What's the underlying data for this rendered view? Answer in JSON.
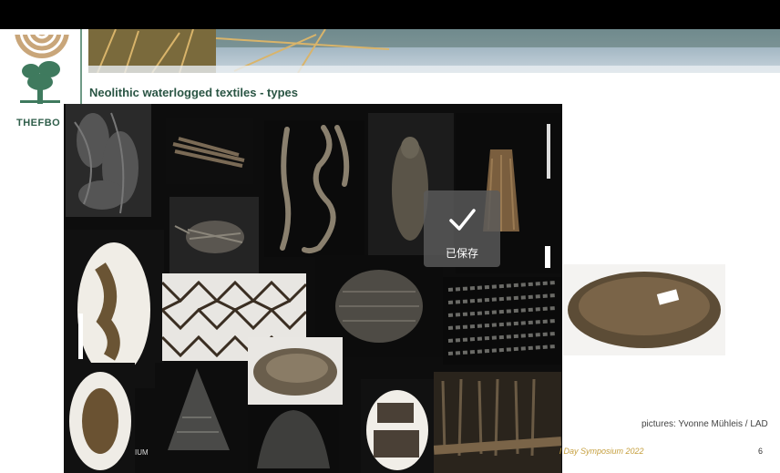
{
  "slide": {
    "logo_text": "THEFBO",
    "title": "Neolithic waterlogged textiles - types",
    "credit": "pictures: Yvonne Mühleis / LAD",
    "footer_left": "l Day Symposium 2022",
    "page_number": "6",
    "scale_label": "IUM"
  },
  "toast": {
    "label": "已保存",
    "icon": "checkmark-icon"
  },
  "colors": {
    "title": "#2a5544",
    "accent_line": "#6f9a86",
    "footer_text": "#c6a040"
  }
}
